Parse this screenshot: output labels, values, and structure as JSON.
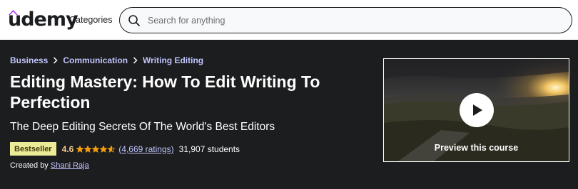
{
  "header": {
    "logo_text": "udemy",
    "categories_label": "Categories",
    "search_placeholder": "Search for anything"
  },
  "breadcrumb": [
    "Business",
    "Communication",
    "Writing Editing"
  ],
  "course": {
    "title": "Editing Mastery: How To Edit Writing To Perfection",
    "subtitle": "The Deep Editing Secrets Of The World's Best Editors",
    "badge": "Bestseller",
    "rating": "4.6",
    "rating_stars": 4.6,
    "ratings_count": "(4,669 ratings)",
    "students": "31,907 students",
    "created_by_label": "Created by",
    "instructor": "Shani Raja"
  },
  "preview": {
    "label": "Preview this course"
  },
  "colors": {
    "background": "#1c1d1f",
    "link": "#c0c4fc",
    "badge_bg": "#eceb98",
    "rating": "#f3ca8c",
    "brand_purple": "#a435f0"
  },
  "icons": {
    "search": "search-icon",
    "play": "play-icon",
    "star": "star-icon",
    "chevron": "chevron-right-icon"
  }
}
